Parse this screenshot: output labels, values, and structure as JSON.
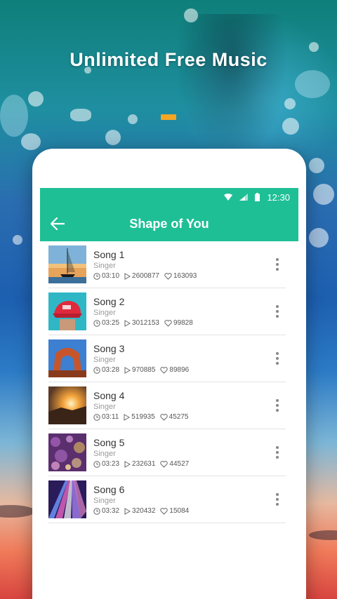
{
  "headline": "Unlimited Free Music",
  "colors": {
    "accent": "#f5a623",
    "primary": "#1fbf96"
  },
  "status_bar": {
    "time": "12:30"
  },
  "app_bar": {
    "title": "Shape of You"
  },
  "songs": [
    {
      "title": "Song 1",
      "singer": "Singer",
      "duration": "03:10",
      "plays": "2600877",
      "likes": "163093",
      "thumb": "sailboat"
    },
    {
      "title": "Song 2",
      "singer": "Singer",
      "duration": "03:25",
      "plays": "3012153",
      "likes": "99828",
      "thumb": "red-cap"
    },
    {
      "title": "Song 3",
      "singer": "Singer",
      "duration": "03:28",
      "plays": "970885",
      "likes": "89896",
      "thumb": "arch-rock"
    },
    {
      "title": "Song 4",
      "singer": "Singer",
      "duration": "03:11",
      "plays": "519935",
      "likes": "45275",
      "thumb": "sunset"
    },
    {
      "title": "Song 5",
      "singer": "Singer",
      "duration": "03:23",
      "plays": "232631",
      "likes": "44527",
      "thumb": "bokeh-purple"
    },
    {
      "title": "Song 6",
      "singer": "Singer",
      "duration": "03:32",
      "plays": "320432",
      "likes": "15084",
      "thumb": "light-trails"
    }
  ]
}
